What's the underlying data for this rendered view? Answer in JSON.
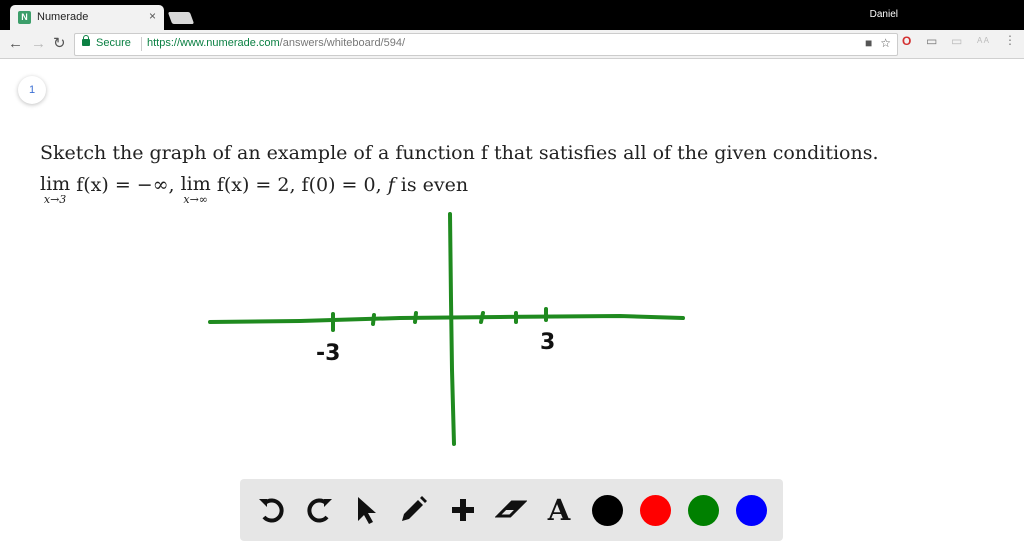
{
  "browser": {
    "tab_title": "Numerade",
    "tab_close": "×",
    "favicon": "N",
    "profile_name": "Daniel",
    "secure_label": "Secure",
    "url_host": "https://www.numerade.com",
    "url_path": "/answers/whiteboard/594/"
  },
  "page": {
    "page_number": "1",
    "question": "Sketch the graph of an example of a function f that satisfies all of the given conditions.",
    "conditions": {
      "lim1": "lim",
      "lim1_sub": "x→3",
      "expr1": " f(x) = −∞, ",
      "lim2": "lim",
      "lim2_sub": "x→∞",
      "expr2": " f(x) = 2, f(0) = 0, ",
      "f": "f",
      "tail": " is even"
    }
  },
  "sketch": {
    "color": "#1f8a1f",
    "tick_labels": [
      "-3",
      "3"
    ]
  },
  "toolbar": {
    "tools": [
      "undo-icon",
      "redo-icon",
      "pointer-icon",
      "pencil-icon",
      "plus-icon",
      "eraser-icon",
      "text-icon"
    ],
    "text_tool": "A",
    "colors": [
      "#000000",
      "#ff0000",
      "#008000",
      "#0000ff"
    ]
  }
}
